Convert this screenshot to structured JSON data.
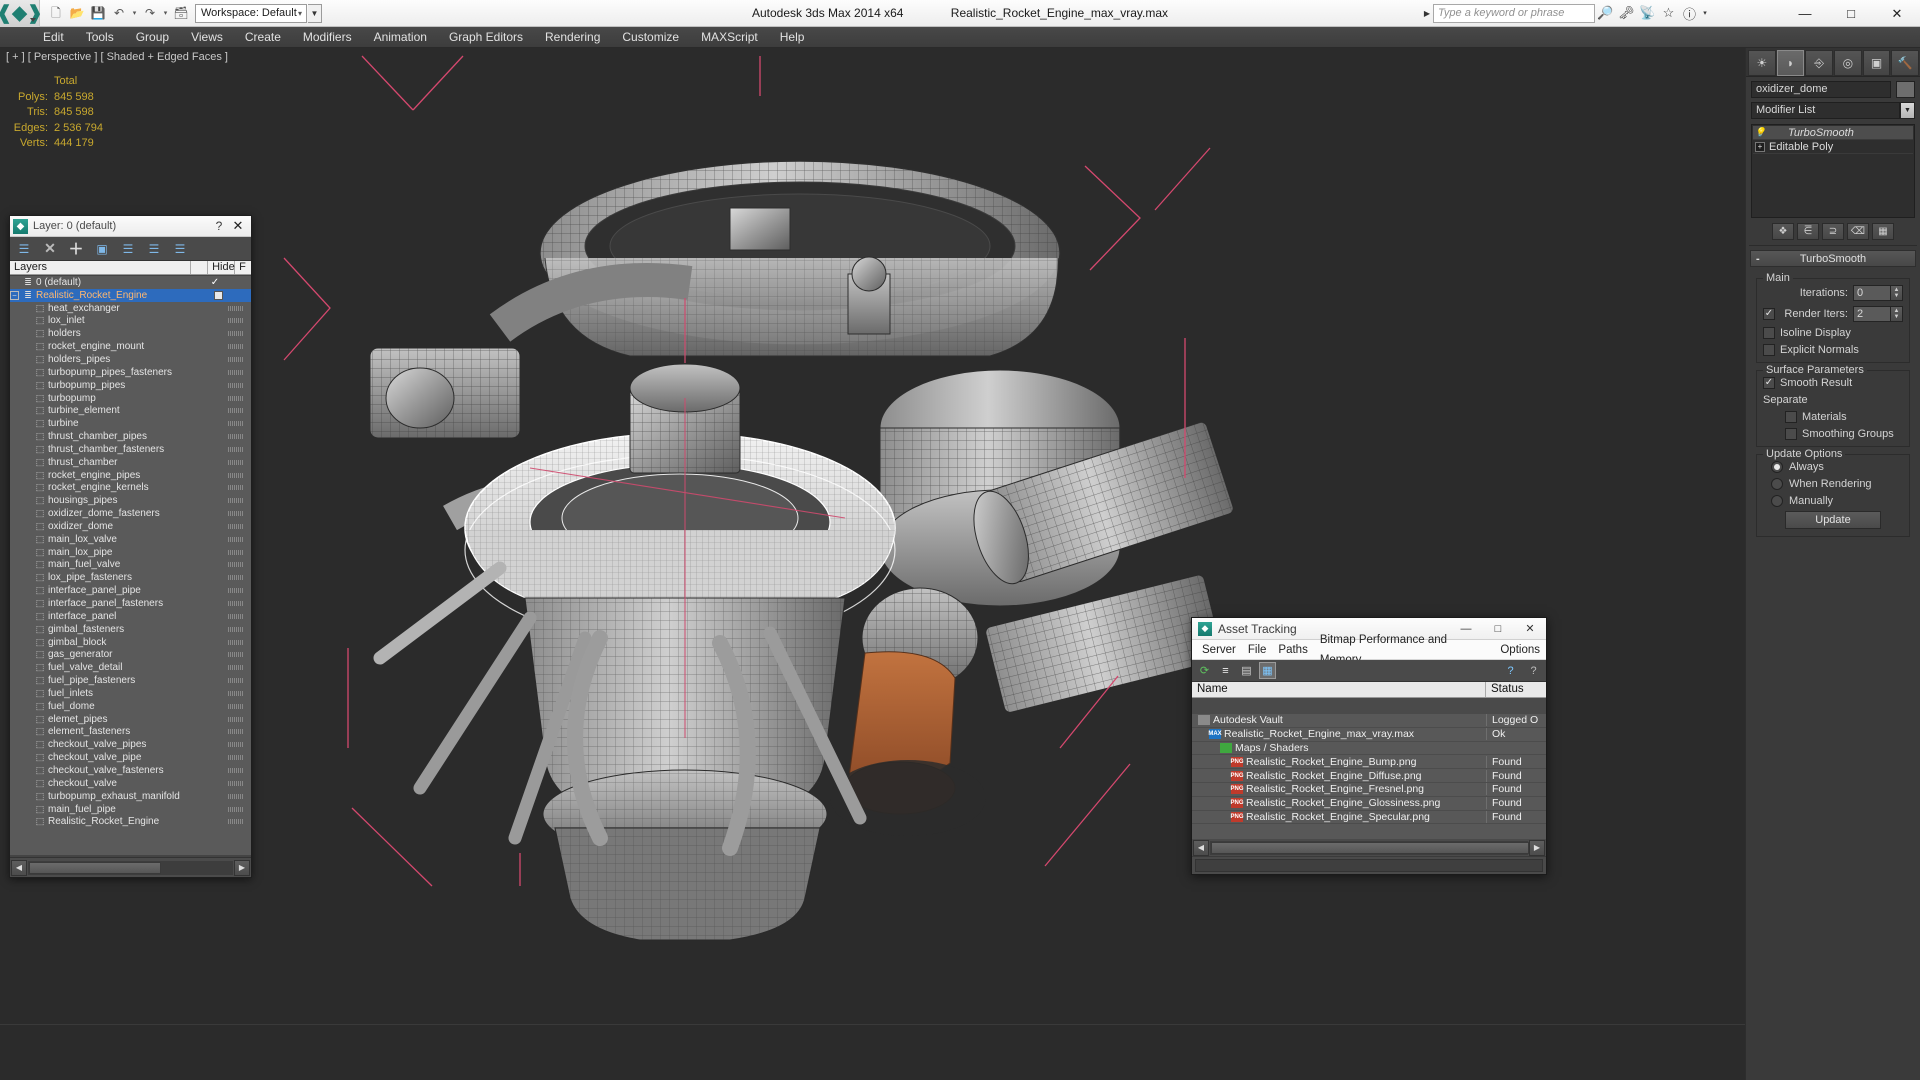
{
  "titlebar": {
    "app_title": "Autodesk 3ds Max  2014 x64",
    "file_title": "Realistic_Rocket_Engine_max_vray.max",
    "workspace_label": "Workspace: Default",
    "quick_access": [
      {
        "name": "new-file-icon",
        "glyph": "⬜"
      },
      {
        "name": "open-file-icon",
        "glyph": "📂"
      },
      {
        "name": "save-file-icon",
        "glyph": "💾"
      },
      {
        "name": "undo-icon",
        "glyph": "↶"
      },
      {
        "name": "undo-dropdown-icon",
        "glyph": "▾"
      },
      {
        "name": "redo-icon",
        "glyph": "↷"
      },
      {
        "name": "redo-dropdown-icon",
        "glyph": "▾"
      },
      {
        "name": "set-project-folder-icon",
        "glyph": "🗂"
      }
    ],
    "search_placeholder": "Type a keyword or phrase",
    "help_icons": [
      {
        "name": "search-binoculars-icon",
        "glyph": "🔍"
      },
      {
        "name": "key-icon",
        "glyph": "🗝"
      },
      {
        "name": "satellite-icon",
        "glyph": "📡"
      },
      {
        "name": "favorites-star-icon",
        "glyph": "☆"
      },
      {
        "name": "help-icon",
        "glyph": "?"
      }
    ],
    "window_buttons": [
      {
        "name": "minimize-button",
        "glyph": "—"
      },
      {
        "name": "maximize-button",
        "glyph": "□"
      },
      {
        "name": "close-button",
        "glyph": "✕"
      }
    ]
  },
  "menubar": {
    "items": [
      "Edit",
      "Tools",
      "Group",
      "Views",
      "Create",
      "Modifiers",
      "Animation",
      "Graph Editors",
      "Rendering",
      "Customize",
      "MAXScript",
      "Help"
    ]
  },
  "viewport": {
    "label": "[ + ] [ Perspective ] [ Shaded + Edged Faces ]",
    "stats": {
      "header": "Total",
      "rows": [
        {
          "label": "Polys:",
          "value": "845 598"
        },
        {
          "label": "Tris:",
          "value": "845 598"
        },
        {
          "label": "Edges:",
          "value": "2 536 794"
        },
        {
          "label": "Verts:",
          "value": "444 179"
        }
      ]
    }
  },
  "command_panel": {
    "tabs": [
      {
        "name": "create-tab",
        "glyph": "☀",
        "active": false
      },
      {
        "name": "modify-tab",
        "glyph": "◜",
        "active": true
      },
      {
        "name": "hierarchy-tab",
        "glyph": "⑂",
        "active": false
      },
      {
        "name": "motion-tab",
        "glyph": "◎",
        "active": false
      },
      {
        "name": "display-tab",
        "glyph": "▣",
        "active": false
      },
      {
        "name": "utilities-tab",
        "glyph": "🔨",
        "active": false
      }
    ],
    "object_name": "oxidizer_dome",
    "modifier_list_label": "Modifier List",
    "modifier_stack": [
      {
        "label": "TurboSmooth",
        "selected": true,
        "icon": "lightbulb-icon"
      },
      {
        "label": "Editable Poly",
        "selected": false,
        "icon": "expand-plus-icon"
      }
    ],
    "stack_tools": [
      {
        "name": "pin-stack-button",
        "glyph": "❖"
      },
      {
        "name": "show-end-result-button",
        "glyph": "⌶"
      },
      {
        "name": "make-unique-button",
        "glyph": "⎇"
      },
      {
        "name": "remove-modifier-button",
        "glyph": "⌫"
      },
      {
        "name": "configure-modifier-sets-button",
        "glyph": "☰"
      }
    ],
    "rollout": {
      "title": "TurboSmooth",
      "main": {
        "group_label": "Main",
        "iterations_label": "Iterations:",
        "iterations_value": "0",
        "render_iters_label": "Render Iters:",
        "render_iters_value": "2",
        "render_iters_checked": true,
        "isoline_display_label": "Isoline Display",
        "isoline_display_checked": false,
        "explicit_normals_label": "Explicit Normals",
        "explicit_normals_checked": false
      },
      "surface": {
        "group_label": "Surface Parameters",
        "smooth_result_label": "Smooth Result",
        "smooth_result_checked": true,
        "separate_label": "Separate",
        "materials_label": "Materials",
        "materials_checked": false,
        "smoothing_groups_label": "Smoothing Groups",
        "smoothing_groups_checked": false
      },
      "update": {
        "group_label": "Update Options",
        "options": [
          {
            "label": "Always",
            "selected": true
          },
          {
            "label": "When Rendering",
            "selected": false
          },
          {
            "label": "Manually",
            "selected": false
          }
        ],
        "button_label": "Update"
      }
    }
  },
  "layer_dialog": {
    "title": "Layer: 0 (default)",
    "help_glyph": "?",
    "close_glyph": "✕",
    "toolbar": [
      {
        "name": "create-new-layer-button",
        "glyph": "≣"
      },
      {
        "name": "delete-layer-button",
        "glyph": "✕"
      },
      {
        "name": "add-selection-to-layer-button",
        "glyph": "＋"
      },
      {
        "name": "select-objects-in-layer-button",
        "glyph": "▣"
      },
      {
        "name": "select-highlighted-layers-button",
        "glyph": "≣"
      },
      {
        "name": "highlight-selected-objects-layer-button",
        "glyph": "≣"
      },
      {
        "name": "layer-properties-button",
        "glyph": "≣"
      }
    ],
    "columns": [
      {
        "label": "Layers",
        "width": 183
      },
      {
        "label": "",
        "width": 17
      },
      {
        "label": "Hide",
        "width": 27
      },
      {
        "label": "F",
        "width": 16
      }
    ],
    "rows": [
      {
        "name": "0 (default)",
        "level": 0,
        "type": "layer",
        "check": "✓"
      },
      {
        "name": "Realistic_Rocket_Engine",
        "level": 0,
        "type": "layer",
        "selected": true,
        "expander": "−",
        "box": true
      },
      {
        "name": "heat_exchanger",
        "level": 1,
        "type": "object"
      },
      {
        "name": "lox_inlet",
        "level": 1,
        "type": "object"
      },
      {
        "name": "holders",
        "level": 1,
        "type": "object"
      },
      {
        "name": "rocket_engine_mount",
        "level": 1,
        "type": "object"
      },
      {
        "name": "holders_pipes",
        "level": 1,
        "type": "object"
      },
      {
        "name": "turbopump_pipes_fasteners",
        "level": 1,
        "type": "object"
      },
      {
        "name": "turbopump_pipes",
        "level": 1,
        "type": "object"
      },
      {
        "name": "turbopump",
        "level": 1,
        "type": "object"
      },
      {
        "name": "turbine_element",
        "level": 1,
        "type": "object"
      },
      {
        "name": "turbine",
        "level": 1,
        "type": "object"
      },
      {
        "name": "thrust_chamber_pipes",
        "level": 1,
        "type": "object"
      },
      {
        "name": "thrust_chamber_fasteners",
        "level": 1,
        "type": "object"
      },
      {
        "name": "thrust_chamber",
        "level": 1,
        "type": "object"
      },
      {
        "name": "rocket_engine_pipes",
        "level": 1,
        "type": "object"
      },
      {
        "name": "rocket_engine_kernels",
        "level": 1,
        "type": "object"
      },
      {
        "name": "housings_pipes",
        "level": 1,
        "type": "object"
      },
      {
        "name": "oxidizer_dome_fasteners",
        "level": 1,
        "type": "object"
      },
      {
        "name": "oxidizer_dome",
        "level": 1,
        "type": "object"
      },
      {
        "name": "main_lox_valve",
        "level": 1,
        "type": "object"
      },
      {
        "name": "main_lox_pipe",
        "level": 1,
        "type": "object"
      },
      {
        "name": "main_fuel_valve",
        "level": 1,
        "type": "object"
      },
      {
        "name": "lox_pipe_fasteners",
        "level": 1,
        "type": "object"
      },
      {
        "name": "interface_panel_pipe",
        "level": 1,
        "type": "object"
      },
      {
        "name": "interface_panel_fasteners",
        "level": 1,
        "type": "object"
      },
      {
        "name": "interface_panel",
        "level": 1,
        "type": "object"
      },
      {
        "name": "gimbal_fasteners",
        "level": 1,
        "type": "object"
      },
      {
        "name": "gimbal_block",
        "level": 1,
        "type": "object"
      },
      {
        "name": "gas_generator",
        "level": 1,
        "type": "object"
      },
      {
        "name": "fuel_valve_detail",
        "level": 1,
        "type": "object"
      },
      {
        "name": "fuel_pipe_fasteners",
        "level": 1,
        "type": "object"
      },
      {
        "name": "fuel_inlets",
        "level": 1,
        "type": "object"
      },
      {
        "name": "fuel_dome",
        "level": 1,
        "type": "object"
      },
      {
        "name": "elemet_pipes",
        "level": 1,
        "type": "object"
      },
      {
        "name": "element_fasteners",
        "level": 1,
        "type": "object"
      },
      {
        "name": "checkout_valve_pipes",
        "level": 1,
        "type": "object"
      },
      {
        "name": "checkout_valve_pipe",
        "level": 1,
        "type": "object"
      },
      {
        "name": "checkout_valve_fasteners",
        "level": 1,
        "type": "object"
      },
      {
        "name": "checkout_valve",
        "level": 1,
        "type": "object"
      },
      {
        "name": "turbopump_exhaust_manifold",
        "level": 1,
        "type": "object"
      },
      {
        "name": "main_fuel_pipe",
        "level": 1,
        "type": "object"
      },
      {
        "name": "Realistic_Rocket_Engine",
        "level": 1,
        "type": "object"
      }
    ]
  },
  "asset_tracking": {
    "title": "Asset Tracking",
    "window_buttons": [
      {
        "name": "minimize-button",
        "glyph": "—"
      },
      {
        "name": "maximize-button",
        "glyph": "□"
      },
      {
        "name": "close-button",
        "glyph": "✕"
      }
    ],
    "menus": [
      "Server",
      "File",
      "Paths",
      "Bitmap Performance and Memory",
      "Options"
    ],
    "toolbar": [
      {
        "name": "refresh-icon",
        "glyph": "⟳",
        "active": false
      },
      {
        "name": "list-view-icon",
        "glyph": "≡",
        "active": false
      },
      {
        "name": "detail-view-icon",
        "glyph": "▤",
        "active": false
      },
      {
        "name": "grid-view-icon",
        "glyph": "▦",
        "active": true
      }
    ],
    "toolbar_right": [
      {
        "name": "help-globe-icon",
        "glyph": "?"
      },
      {
        "name": "help-cursor-icon",
        "glyph": "?"
      }
    ],
    "columns": [
      "Name",
      "Status"
    ],
    "rows": [
      {
        "name": "Autodesk Vault",
        "status": "Logged O",
        "level": 0,
        "icon": "ico-vault",
        "icon_text": ""
      },
      {
        "name": "Realistic_Rocket_Engine_max_vray.max",
        "status": "Ok",
        "level": 1,
        "icon": "ico-max",
        "icon_text": "MAX"
      },
      {
        "name": "Maps / Shaders",
        "status": "",
        "level": 2,
        "icon": "ico-maps",
        "icon_text": ""
      },
      {
        "name": "Realistic_Rocket_Engine_Bump.png",
        "status": "Found",
        "level": 3,
        "icon": "ico-png",
        "icon_text": "PNG"
      },
      {
        "name": "Realistic_Rocket_Engine_Diffuse.png",
        "status": "Found",
        "level": 3,
        "icon": "ico-png",
        "icon_text": "PNG"
      },
      {
        "name": "Realistic_Rocket_Engine_Fresnel.png",
        "status": "Found",
        "level": 3,
        "icon": "ico-png",
        "icon_text": "PNG"
      },
      {
        "name": "Realistic_Rocket_Engine_Glossiness.png",
        "status": "Found",
        "level": 3,
        "icon": "ico-png",
        "icon_text": "PNG"
      },
      {
        "name": "Realistic_Rocket_Engine_Specular.png",
        "status": "Found",
        "level": 3,
        "icon": "ico-png",
        "icon_text": "PNG"
      }
    ],
    "scroll_left_glyph": "◀",
    "scroll_right_glyph": "▶"
  },
  "colors": {
    "viewport_bg": "#2b2b2b",
    "stats_text": "#c8a82e",
    "selection_blue": "#2d6bbd",
    "selection_text": "#ffb870",
    "panel_bg": "#3a3a3a",
    "gizmo_pink": "#d4486e",
    "nozzle_copper": "#b5663a"
  }
}
